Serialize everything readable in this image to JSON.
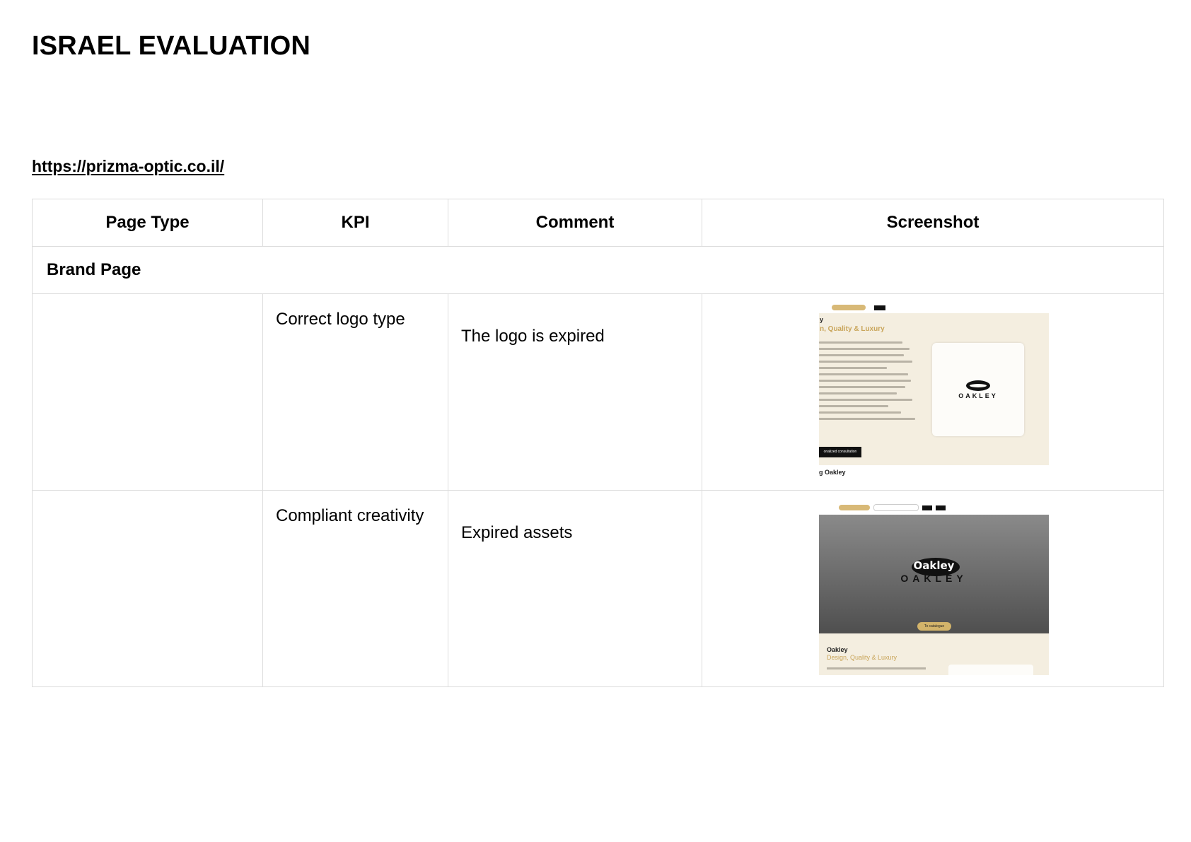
{
  "document": {
    "title": "ISRAEL EVALUATION",
    "url": "https://prizma-optic.co.il/"
  },
  "table": {
    "headers": [
      "Page Type",
      "KPI",
      "Comment",
      "Screenshot"
    ],
    "section_label": "Brand Page",
    "rows": [
      {
        "page_type": "",
        "kpi": "Correct logo type",
        "comment": "The logo is expired"
      },
      {
        "page_type": "",
        "kpi": "Compliant creativity",
        "comment": "Expired assets"
      }
    ]
  },
  "screenshot1": {
    "heading": "y",
    "subheading": "n, Quality & Luxury",
    "logo_wordmark": "OAKLEY",
    "button": "onalized consultation",
    "footer": "g Oakley"
  },
  "screenshot2": {
    "hero_brand": "Oakley",
    "logo_wordmark": "OAKLEY",
    "cta": "To catalogue",
    "brand_name": "Oakley",
    "tagline": "Design, Quality & Luxury"
  },
  "colors": {
    "border": "#dcdcdc",
    "gold": "#c9a55a",
    "cream": "#f4eee0"
  }
}
